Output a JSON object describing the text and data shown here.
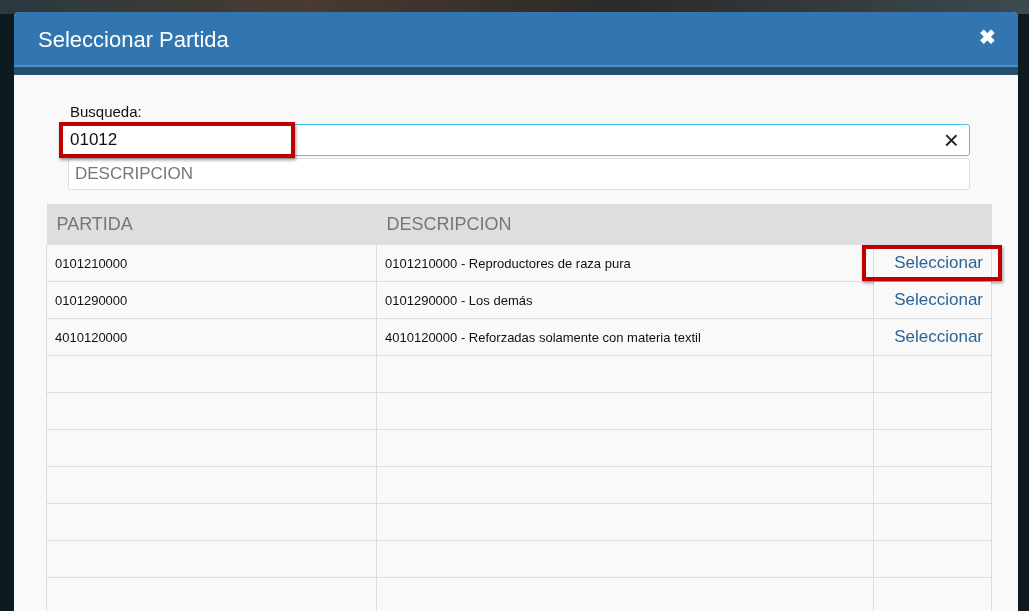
{
  "dialog": {
    "title": "Seleccionar Partida",
    "close": "✖"
  },
  "search": {
    "label": "Busqueda:",
    "value": "01012",
    "clear": "×",
    "highlighted": true
  },
  "filter": {
    "placeholder": "DESCRIPCION"
  },
  "table": {
    "columns": [
      "PARTIDA",
      "DESCRIPCION"
    ],
    "rows": [
      {
        "partida": "0101210000",
        "descripcion": "0101210000 - Reproductores de raza pura",
        "action": "Seleccionar",
        "highlighted": true
      },
      {
        "partida": "0101290000",
        "descripcion": "0101290000 - Los demás",
        "action": "Seleccionar",
        "highlighted": false
      },
      {
        "partida": "4010120000",
        "descripcion": "4010120000 - Reforzadas solamente con materia textil",
        "action": "Seleccionar",
        "highlighted": false
      }
    ]
  }
}
